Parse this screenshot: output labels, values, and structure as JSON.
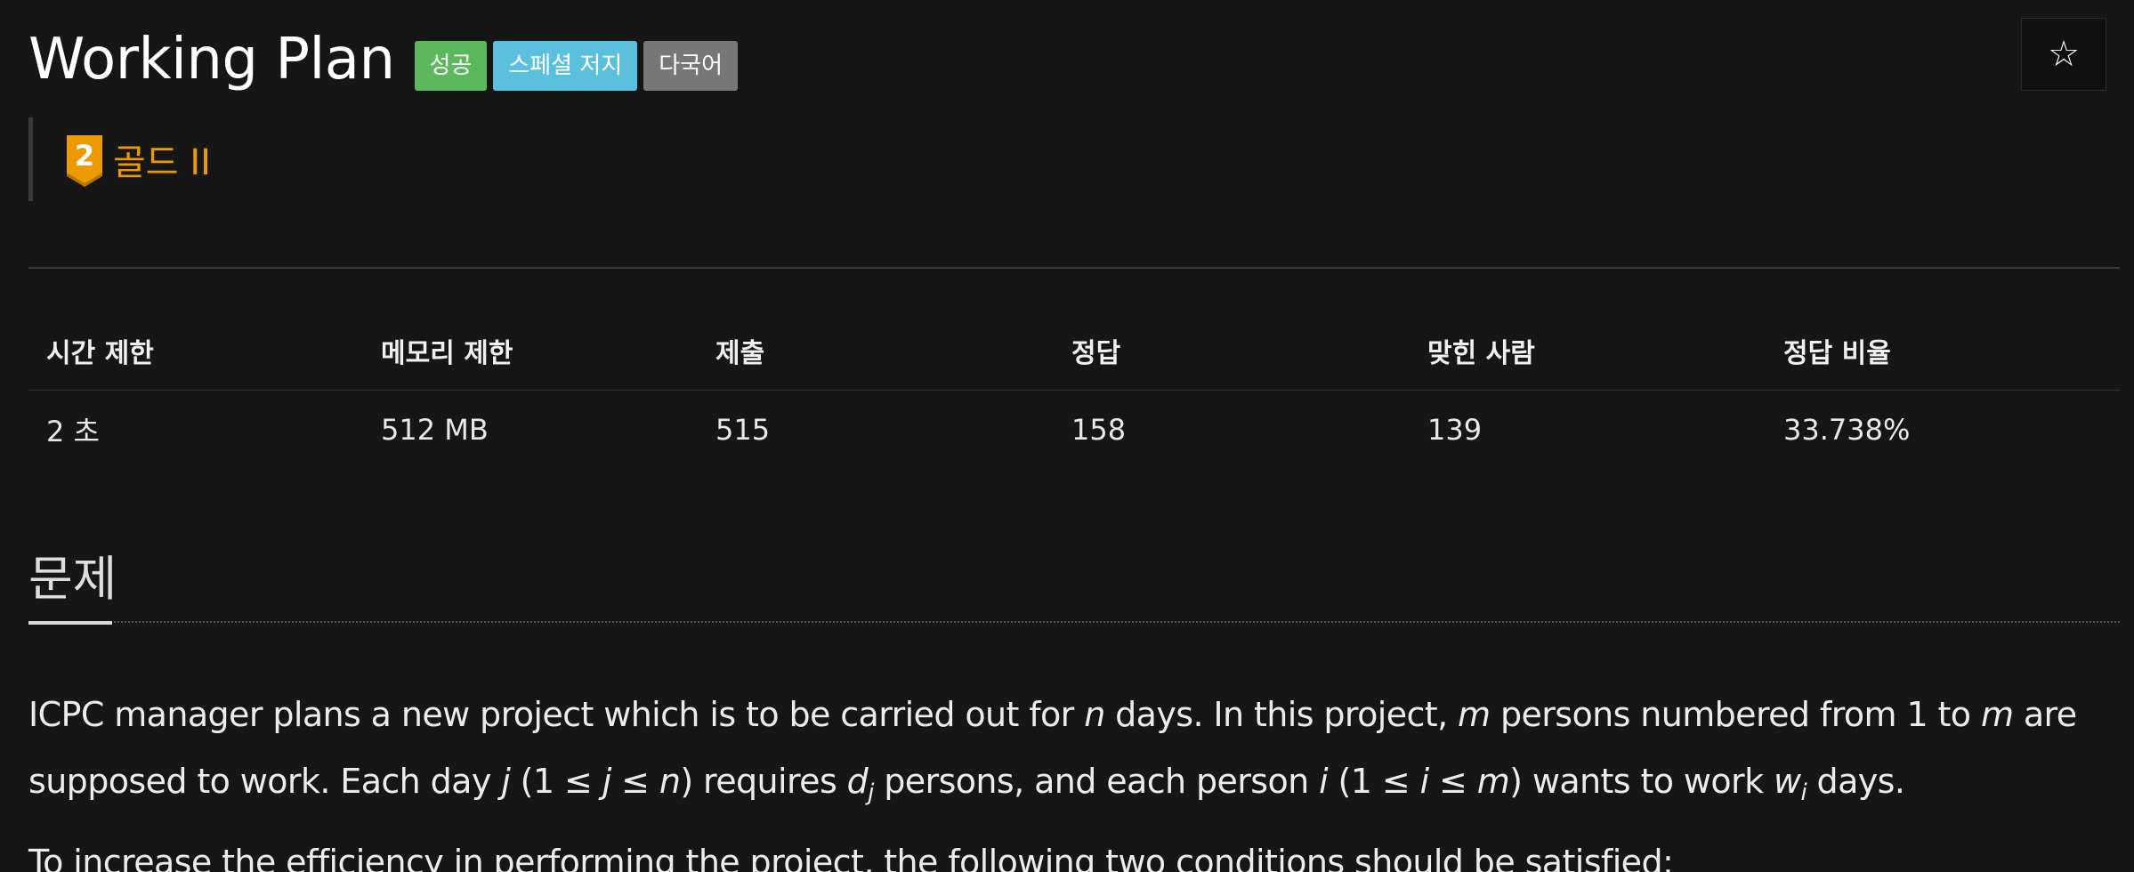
{
  "problem": {
    "title": "Working Plan",
    "badges": [
      "성공",
      "스페셜 저지",
      "다국어"
    ],
    "star_icon": "☆",
    "tier": {
      "name": "골드 II",
      "level": "2",
      "icon": "gold-tier-icon",
      "color": "#ec9a00"
    }
  },
  "info_table": {
    "headers": [
      "시간 제한",
      "메모리 제한",
      "제출",
      "정답",
      "맞힌 사람",
      "정답 비율"
    ],
    "values": [
      "2 초",
      "512 MB",
      "515",
      "158",
      "139",
      "33.738%"
    ]
  },
  "section": {
    "title": "문제"
  },
  "description": {
    "line1": {
      "a": "ICPC manager plans a new project which is to be carried out for ",
      "n": "n",
      "b": " days. In this project, ",
      "m1": "m",
      "c": " persons numbered from 1 to ",
      "m2": "m",
      "d": " are"
    },
    "line2": {
      "a": "supposed to work. Each day ",
      "j1": "j",
      "b": " (1 ≤ ",
      "j2": "j",
      "c": " ≤ ",
      "n": "n",
      "d": ") requires ",
      "dvar": "d",
      "dsub": "j",
      "e": " persons, and each person ",
      "i1": "i",
      "f": " (1 ≤ ",
      "i2": "i",
      "g": " ≤ ",
      "m": "m",
      "h": ") wants to work ",
      "wvar": "w",
      "wsub": "i",
      "k": " days."
    },
    "line3": "To increase the efficiency in performing the project, the following two conditions should be satisfied:"
  },
  "colors": {
    "background": "#161616",
    "success": "#5cb85c",
    "special": "#5bc0de",
    "multi": "#777777",
    "gold": "#ec9a00"
  }
}
